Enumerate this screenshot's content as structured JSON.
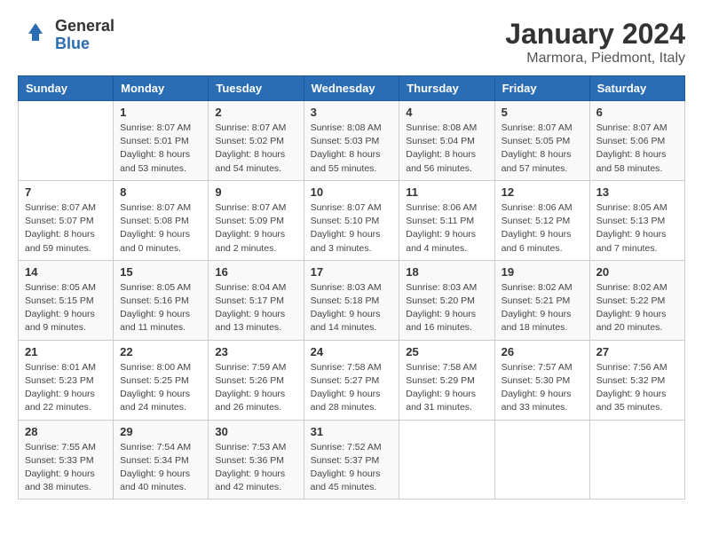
{
  "logo": {
    "general": "General",
    "blue": "Blue"
  },
  "title": "January 2024",
  "subtitle": "Marmora, Piedmont, Italy",
  "days_header": [
    "Sunday",
    "Monday",
    "Tuesday",
    "Wednesday",
    "Thursday",
    "Friday",
    "Saturday"
  ],
  "weeks": [
    [
      {
        "day": "",
        "info": ""
      },
      {
        "day": "1",
        "info": "Sunrise: 8:07 AM\nSunset: 5:01 PM\nDaylight: 8 hours\nand 53 minutes."
      },
      {
        "day": "2",
        "info": "Sunrise: 8:07 AM\nSunset: 5:02 PM\nDaylight: 8 hours\nand 54 minutes."
      },
      {
        "day": "3",
        "info": "Sunrise: 8:08 AM\nSunset: 5:03 PM\nDaylight: 8 hours\nand 55 minutes."
      },
      {
        "day": "4",
        "info": "Sunrise: 8:08 AM\nSunset: 5:04 PM\nDaylight: 8 hours\nand 56 minutes."
      },
      {
        "day": "5",
        "info": "Sunrise: 8:07 AM\nSunset: 5:05 PM\nDaylight: 8 hours\nand 57 minutes."
      },
      {
        "day": "6",
        "info": "Sunrise: 8:07 AM\nSunset: 5:06 PM\nDaylight: 8 hours\nand 58 minutes."
      }
    ],
    [
      {
        "day": "7",
        "info": "Sunrise: 8:07 AM\nSunset: 5:07 PM\nDaylight: 8 hours\nand 59 minutes."
      },
      {
        "day": "8",
        "info": "Sunrise: 8:07 AM\nSunset: 5:08 PM\nDaylight: 9 hours\nand 0 minutes."
      },
      {
        "day": "9",
        "info": "Sunrise: 8:07 AM\nSunset: 5:09 PM\nDaylight: 9 hours\nand 2 minutes."
      },
      {
        "day": "10",
        "info": "Sunrise: 8:07 AM\nSunset: 5:10 PM\nDaylight: 9 hours\nand 3 minutes."
      },
      {
        "day": "11",
        "info": "Sunrise: 8:06 AM\nSunset: 5:11 PM\nDaylight: 9 hours\nand 4 minutes."
      },
      {
        "day": "12",
        "info": "Sunrise: 8:06 AM\nSunset: 5:12 PM\nDaylight: 9 hours\nand 6 minutes."
      },
      {
        "day": "13",
        "info": "Sunrise: 8:05 AM\nSunset: 5:13 PM\nDaylight: 9 hours\nand 7 minutes."
      }
    ],
    [
      {
        "day": "14",
        "info": "Sunrise: 8:05 AM\nSunset: 5:15 PM\nDaylight: 9 hours\nand 9 minutes."
      },
      {
        "day": "15",
        "info": "Sunrise: 8:05 AM\nSunset: 5:16 PM\nDaylight: 9 hours\nand 11 minutes."
      },
      {
        "day": "16",
        "info": "Sunrise: 8:04 AM\nSunset: 5:17 PM\nDaylight: 9 hours\nand 13 minutes."
      },
      {
        "day": "17",
        "info": "Sunrise: 8:03 AM\nSunset: 5:18 PM\nDaylight: 9 hours\nand 14 minutes."
      },
      {
        "day": "18",
        "info": "Sunrise: 8:03 AM\nSunset: 5:20 PM\nDaylight: 9 hours\nand 16 minutes."
      },
      {
        "day": "19",
        "info": "Sunrise: 8:02 AM\nSunset: 5:21 PM\nDaylight: 9 hours\nand 18 minutes."
      },
      {
        "day": "20",
        "info": "Sunrise: 8:02 AM\nSunset: 5:22 PM\nDaylight: 9 hours\nand 20 minutes."
      }
    ],
    [
      {
        "day": "21",
        "info": "Sunrise: 8:01 AM\nSunset: 5:23 PM\nDaylight: 9 hours\nand 22 minutes."
      },
      {
        "day": "22",
        "info": "Sunrise: 8:00 AM\nSunset: 5:25 PM\nDaylight: 9 hours\nand 24 minutes."
      },
      {
        "day": "23",
        "info": "Sunrise: 7:59 AM\nSunset: 5:26 PM\nDaylight: 9 hours\nand 26 minutes."
      },
      {
        "day": "24",
        "info": "Sunrise: 7:58 AM\nSunset: 5:27 PM\nDaylight: 9 hours\nand 28 minutes."
      },
      {
        "day": "25",
        "info": "Sunrise: 7:58 AM\nSunset: 5:29 PM\nDaylight: 9 hours\nand 31 minutes."
      },
      {
        "day": "26",
        "info": "Sunrise: 7:57 AM\nSunset: 5:30 PM\nDaylight: 9 hours\nand 33 minutes."
      },
      {
        "day": "27",
        "info": "Sunrise: 7:56 AM\nSunset: 5:32 PM\nDaylight: 9 hours\nand 35 minutes."
      }
    ],
    [
      {
        "day": "28",
        "info": "Sunrise: 7:55 AM\nSunset: 5:33 PM\nDaylight: 9 hours\nand 38 minutes."
      },
      {
        "day": "29",
        "info": "Sunrise: 7:54 AM\nSunset: 5:34 PM\nDaylight: 9 hours\nand 40 minutes."
      },
      {
        "day": "30",
        "info": "Sunrise: 7:53 AM\nSunset: 5:36 PM\nDaylight: 9 hours\nand 42 minutes."
      },
      {
        "day": "31",
        "info": "Sunrise: 7:52 AM\nSunset: 5:37 PM\nDaylight: 9 hours\nand 45 minutes."
      },
      {
        "day": "",
        "info": ""
      },
      {
        "day": "",
        "info": ""
      },
      {
        "day": "",
        "info": ""
      }
    ]
  ]
}
